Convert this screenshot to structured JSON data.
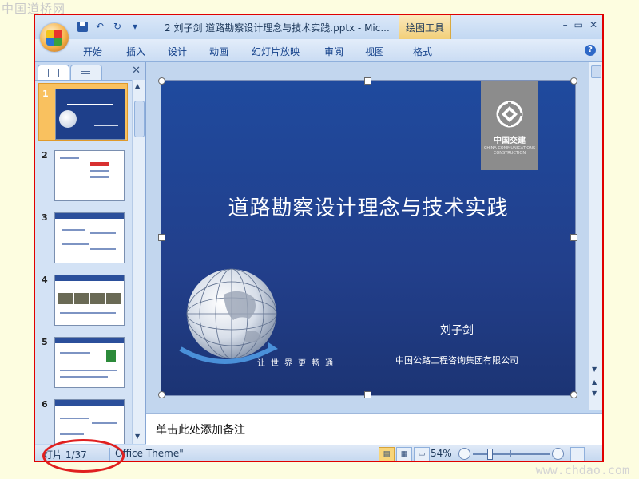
{
  "watermarks": {
    "top_left": "中国道桥网",
    "bottom_right": "www.chdao.com"
  },
  "title_bar": {
    "title": "2 刘子剑 道路勘察设计理念与技术实践.pptx - Mic...",
    "context_tab": "绘图工具",
    "quick_access": [
      "save-icon",
      "undo-icon",
      "redo-icon",
      "customize-icon"
    ],
    "window_controls": [
      "–",
      "▭",
      "✕"
    ]
  },
  "ribbon": {
    "tabs": [
      "开始",
      "插入",
      "设计",
      "动画",
      "幻灯片放映",
      "审阅",
      "视图",
      "格式"
    ],
    "help": "?"
  },
  "left_pane": {
    "tabs": [
      "slides-tab",
      "outline-tab"
    ],
    "close": "✕",
    "slide_numbers": [
      "1",
      "2",
      "3",
      "4",
      "5",
      "6"
    ],
    "selected_slide": 1
  },
  "slide": {
    "title": "道路勘察设计理念与技术实践",
    "author": "刘子剑",
    "organization": "中国公路工程咨询集团有限公司",
    "slogan": "让世界更畅通",
    "logo": {
      "cn": "中国交建",
      "en": "CHINA COMMUNICATIONS CONSTRUCTION"
    }
  },
  "notes": {
    "placeholder": "单击此处添加备注"
  },
  "status_bar": {
    "slide_indicator": "灯片 1/37",
    "theme": "Office Theme\"",
    "zoom": "54%",
    "zoom_minus": "−",
    "zoom_plus": "+"
  },
  "colors": {
    "slide_bg": "#1f4a9e",
    "annotation_red": "#e00000",
    "selected_thumb": "#f9c15f"
  }
}
